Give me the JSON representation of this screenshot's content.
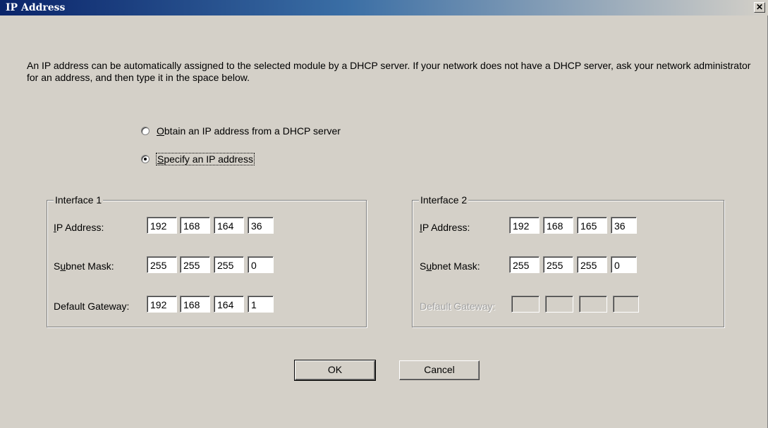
{
  "window": {
    "title": "IP Address",
    "close_glyph": "✕"
  },
  "intro_text": "An IP address can be automatically assigned to the selected module by a DHCP server. If your network does not have a DHCP server, ask your network administrator for an address, and then type it in the space below.",
  "mode": {
    "options": [
      {
        "label": "Obtain an IP address from a DHCP server",
        "mnemonic": "O",
        "rest": "btain an IP address from a DHCP server",
        "checked": false
      },
      {
        "label": "Specify an IP address",
        "mnemonic": "S",
        "rest": "pecify an IP address",
        "checked": true
      }
    ]
  },
  "interfaces": [
    {
      "title": "Interface 1",
      "ip_label": {
        "mnemonic": "I",
        "rest": "P Address:"
      },
      "mask_label": {
        "pre": "S",
        "mnemonic": "u",
        "rest": "bnet Mask:"
      },
      "gateway_label": "Default Gateway:",
      "ip": [
        "192",
        "168",
        "164",
        "36"
      ],
      "mask": [
        "255",
        "255",
        "255",
        "0"
      ],
      "gateway": [
        "192",
        "168",
        "164",
        "1"
      ],
      "gateway_enabled": true
    },
    {
      "title": "Interface 2",
      "ip_label": {
        "mnemonic": "I",
        "rest": "P Address:"
      },
      "mask_label": {
        "pre": "S",
        "mnemonic": "u",
        "rest": "bnet Mask:"
      },
      "gateway_label": "Default Gateway:",
      "ip": [
        "192",
        "168",
        "165",
        "36"
      ],
      "mask": [
        "255",
        "255",
        "255",
        "0"
      ],
      "gateway": [
        "",
        "",
        "",
        ""
      ],
      "gateway_enabled": false
    }
  ],
  "buttons": {
    "ok_label": "OK",
    "cancel_label": "Cancel"
  },
  "colors": {
    "title_gradient_start": "#0a246a",
    "title_gradient_end": "#3a6ea5",
    "dialog_bg": "#d4d0c8"
  }
}
